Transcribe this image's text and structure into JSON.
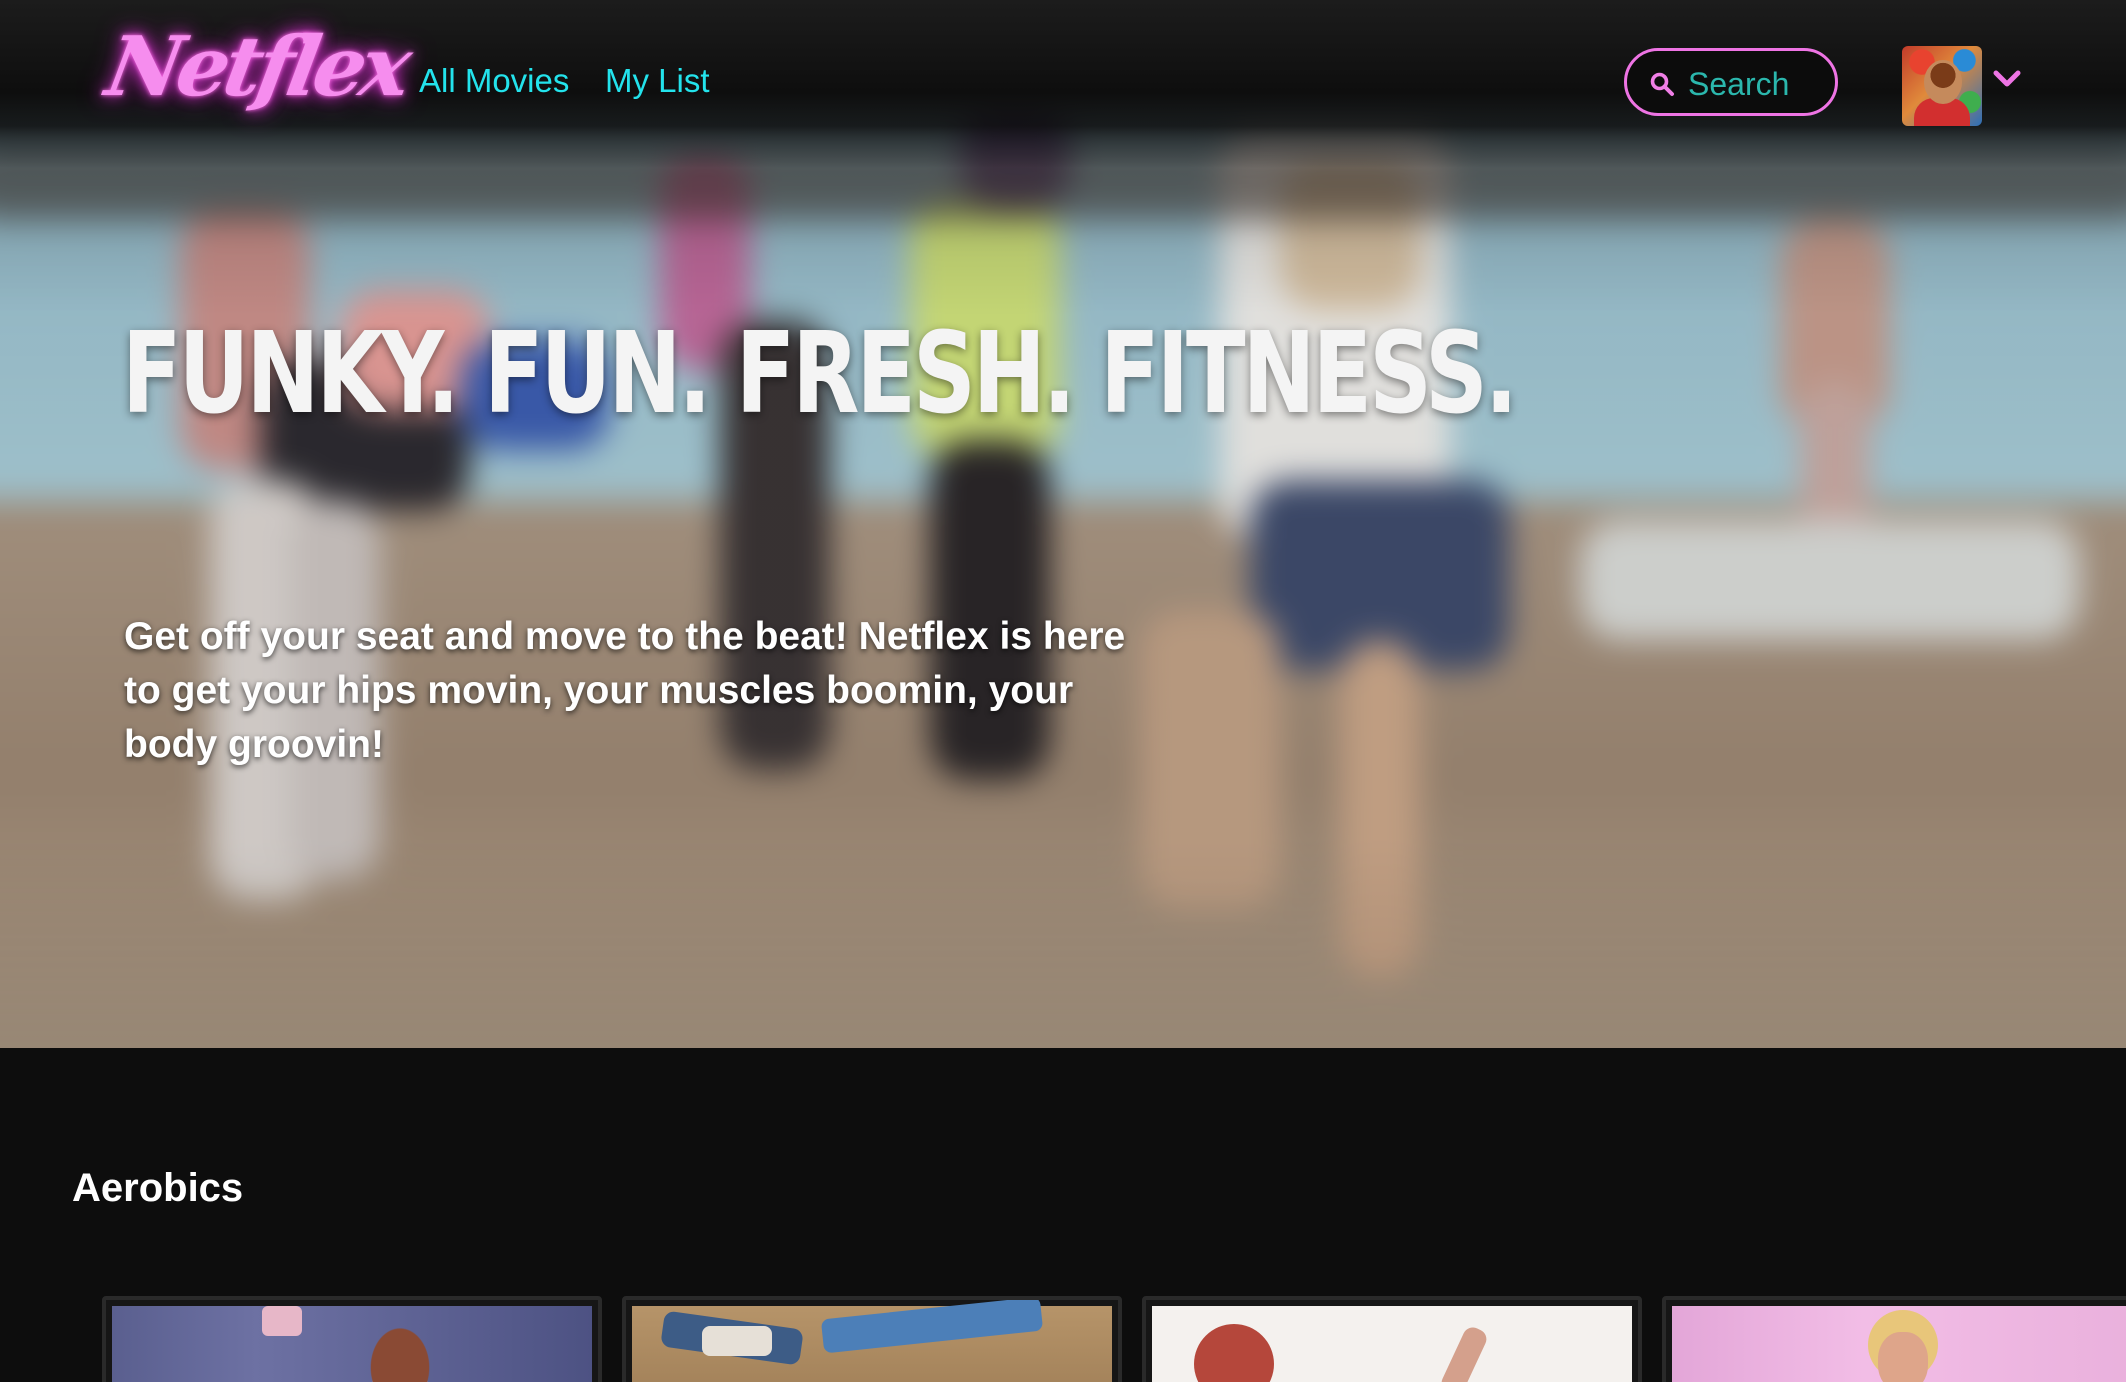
{
  "app": {
    "logo_text": "Netflex"
  },
  "nav": {
    "links": [
      {
        "label": "All Movies"
      },
      {
        "label": "My List"
      }
    ],
    "search": {
      "placeholder": "Search",
      "icon": "search-icon"
    },
    "profile": {
      "avatar_icon": "avatar",
      "menu_icon": "chevron-down-icon"
    }
  },
  "hero": {
    "title": "FUNKY. FUN. FRESH. FITNESS.",
    "description": "Get off your seat and move to the beat! Netflex is here to get your hips movin, your muscles boomin, your body groovin!"
  },
  "rows": [
    {
      "title": "Aerobics",
      "cards": [
        {
          "thumbnail": "aerobics-video-1"
        },
        {
          "thumbnail": "aerobics-video-2"
        },
        {
          "thumbnail": "aerobics-video-3"
        },
        {
          "thumbnail": "aerobics-video-4"
        }
      ]
    }
  ],
  "colors": {
    "accent_pink": "#ee74e4",
    "accent_cyan": "#23e3ec",
    "search_text": "#2bb7ad",
    "background": "#0d0d0d"
  }
}
